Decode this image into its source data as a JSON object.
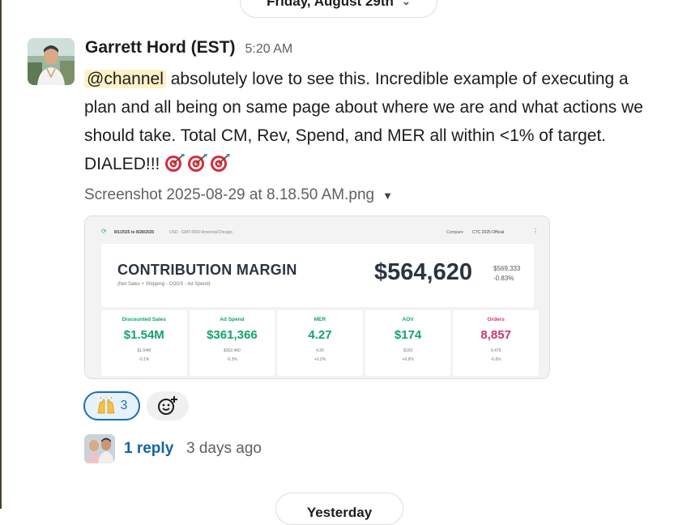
{
  "date_divider": {
    "label": "Friday, August 29th"
  },
  "message": {
    "author": "Garrett Hord (EST)",
    "time": "5:20 AM",
    "mention": "@channel",
    "text": " absolutely love to see this. Incredible example of executing a plan and all being on same page about where we are and what actions we should take. Total CM, Rev, Spend, and MER all within <1% of target. DIALED!!! ",
    "emoji": [
      "direct-hit-icon",
      "direct-hit-icon",
      "direct-hit-icon"
    ]
  },
  "attachment": {
    "file_name": "Screenshot 2025-08-29 at 8.18.50 AM.png",
    "preview": {
      "date_range": "8/1/2025 to 8/28/2025",
      "timezone": "USD · GMT-0600 America/Chicago",
      "compare_label": "Compare:",
      "compare_value": "CTC 2025 Official",
      "cm_title": "CONTRIBUTION MARGIN",
      "cm_subtitle": "(Net Sales + Shipping - COGS - Ad Spend)",
      "cm_value": "$564,620",
      "cm_target": "$569,333",
      "cm_delta": "-0.83%",
      "kpis": [
        {
          "label": "Discounted Sales",
          "value": "$1.54M",
          "target": "$1.54M",
          "delta": "-0.1%",
          "color": "green"
        },
        {
          "label": "Ad Spend",
          "value": "$361,366",
          "target": "$362,460",
          "delta": "-0.3%",
          "color": "green"
        },
        {
          "label": "MER",
          "value": "4.27",
          "target": "4.26",
          "delta": "+0.2%",
          "color": "green"
        },
        {
          "label": "AOV",
          "value": "$174",
          "target": "$163",
          "delta": "+6.9%",
          "color": "green"
        },
        {
          "label": "Orders",
          "value": "8,857",
          "target": "9,479",
          "delta": "-6.6%",
          "color": "pink"
        }
      ]
    }
  },
  "reactions": [
    {
      "emoji": "raised-hands-icon",
      "count": "3"
    }
  ],
  "thread": {
    "reply_count": "1 reply",
    "last_reply": "3 days ago"
  },
  "next_divider": {
    "label": "Yesterday"
  },
  "colors": {
    "link": "#1264a3",
    "mention_bg": "#fdf1c8",
    "reaction_border": "#1d6fb3",
    "kpi_green": "#12a36a",
    "kpi_pink": "#d1356e"
  }
}
